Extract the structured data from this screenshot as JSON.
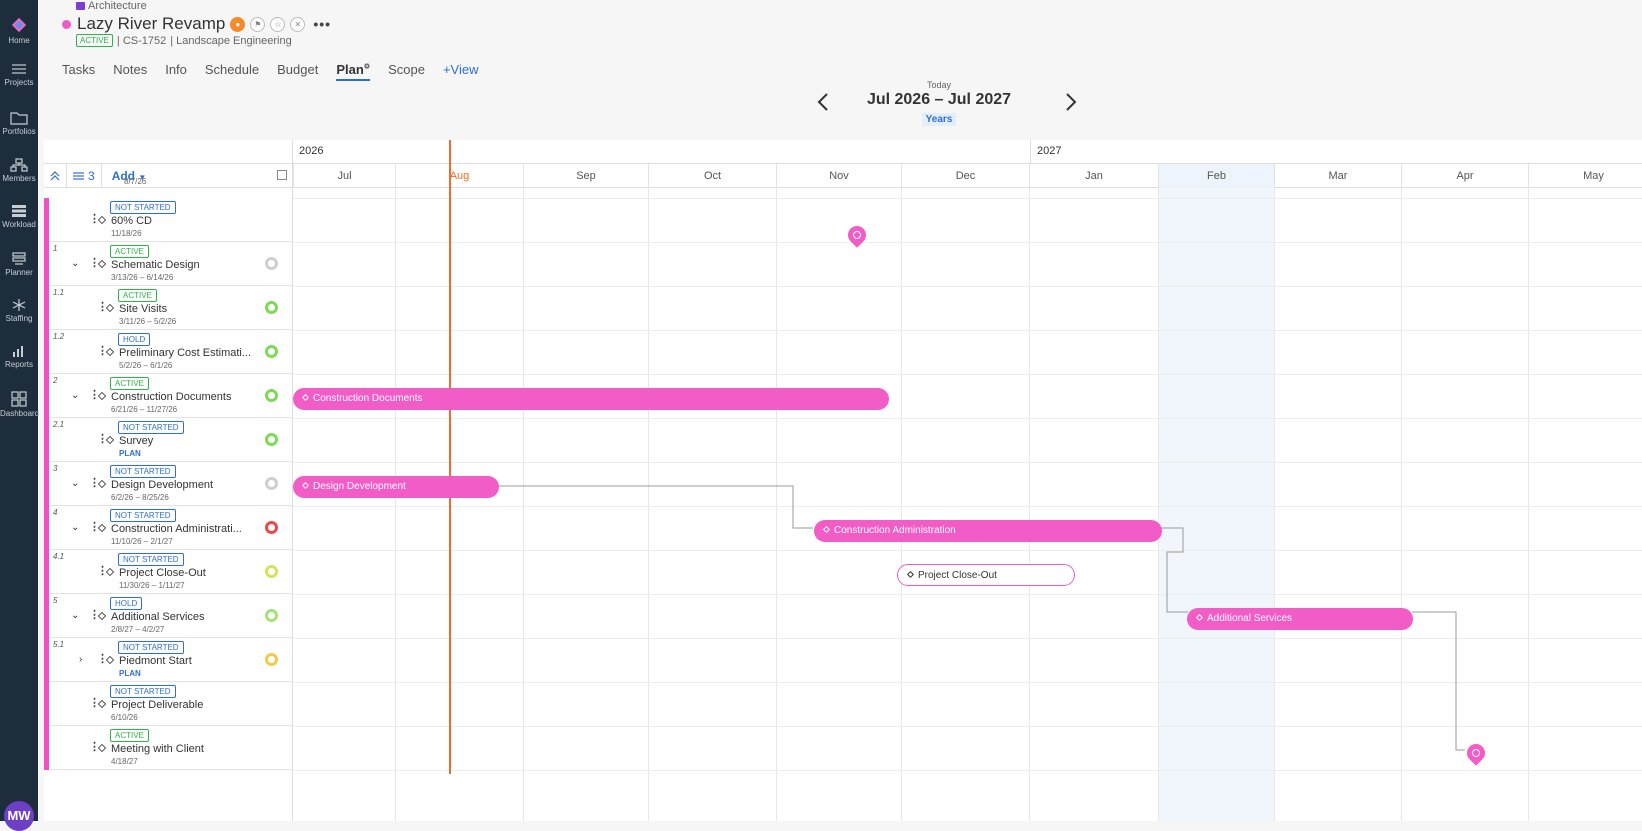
{
  "sidebar": {
    "items": [
      {
        "label": "Home",
        "icon": "home-icon"
      },
      {
        "label": "Projects",
        "icon": "list-icon"
      },
      {
        "label": "Portfolios",
        "icon": "folder-icon"
      },
      {
        "label": "Members",
        "icon": "members-icon"
      },
      {
        "label": "Workload",
        "icon": "grid-icon"
      },
      {
        "label": "Planner",
        "icon": "planner-icon"
      },
      {
        "label": "Staffing",
        "icon": "staffing-icon"
      },
      {
        "label": "Reports",
        "icon": "bar-chart-icon"
      },
      {
        "label": "Dashboard",
        "icon": "dashboard-icon"
      }
    ],
    "avatar_initials": "MW"
  },
  "header": {
    "breadcrumb": "Architecture",
    "title": "Lazy River Revamp",
    "status": "ACTIVE",
    "project_code": "| CS-1752",
    "client": "| Landscape Engineering",
    "more": "•••"
  },
  "tabs": [
    {
      "label": "Tasks"
    },
    {
      "label": "Notes"
    },
    {
      "label": "Info"
    },
    {
      "label": "Schedule"
    },
    {
      "label": "Budget"
    },
    {
      "label": "Plan",
      "active": true
    },
    {
      "label": "Scope"
    },
    {
      "label": "+View"
    }
  ],
  "date_nav": {
    "today": "Today",
    "range": "Jul 2026 – Jul 2027",
    "scale": "Years"
  },
  "toolbar": {
    "filter_count": "3",
    "add_label": "Add"
  },
  "timeline": {
    "years": [
      "2026",
      "2027"
    ],
    "months": [
      "Jul",
      "Aug",
      "Sep",
      "Oct",
      "Nov",
      "Dec",
      "Jan",
      "Feb",
      "Mar",
      "Apr",
      "May"
    ],
    "current_month": "Aug",
    "today_color": "#f06b2b",
    "accent": "#f25cc6"
  },
  "top_partial_date": "8/7/26",
  "rows": [
    {
      "num": "",
      "status": "NOT STARTED",
      "name": "60% CD",
      "dates": "11/18/26",
      "type": "milestone",
      "indent": 0
    },
    {
      "num": "1",
      "status": "ACTIVE",
      "name": "Schematic Design",
      "dates": "3/13/26 – 6/14/26",
      "type": "phase",
      "indent": 0
    },
    {
      "num": "1.1",
      "status": "ACTIVE",
      "name": "Site Visits",
      "dates": "3/11/26 – 5/2/26",
      "type": "sub",
      "indent": 1
    },
    {
      "num": "1.2",
      "status": "HOLD",
      "name": "Preliminary Cost Estimati...",
      "dates": "5/2/26 – 6/1/26",
      "type": "sub",
      "indent": 1
    },
    {
      "num": "2",
      "status": "ACTIVE",
      "name": "Construction Documents",
      "dates": "6/21/26 – 11/27/26",
      "type": "phase",
      "indent": 0
    },
    {
      "num": "2.1",
      "status": "NOT STARTED",
      "name": "Survey",
      "dates": "PLAN",
      "type": "sub",
      "indent": 1
    },
    {
      "num": "3",
      "status": "NOT STARTED",
      "name": "Design Development",
      "dates": "6/2/26 – 8/25/26",
      "type": "phase",
      "indent": 0
    },
    {
      "num": "4",
      "status": "NOT STARTED",
      "name": "Construction Administrati...",
      "dates": "11/10/26 – 2/1/27",
      "type": "phase",
      "indent": 0
    },
    {
      "num": "4.1",
      "status": "NOT STARTED",
      "name": "Project Close-Out",
      "dates": "11/30/26 – 1/11/27",
      "type": "sub",
      "indent": 1
    },
    {
      "num": "5",
      "status": "HOLD",
      "name": "Additional Services",
      "dates": "2/8/27 – 4/2/27",
      "type": "phase",
      "indent": 0
    },
    {
      "num": "5.1",
      "status": "NOT STARTED",
      "name": "Piedmont Start",
      "dates": "PLAN",
      "type": "sub",
      "indent": 1
    },
    {
      "num": "",
      "status": "NOT STARTED",
      "name": "Project Deliverable",
      "dates": "6/10/26",
      "type": "milestone",
      "indent": 0
    },
    {
      "num": "",
      "status": "ACTIVE",
      "name": "Meeting with Client",
      "dates": "4/18/27",
      "type": "milestone",
      "indent": 0
    }
  ],
  "bars": [
    {
      "label": "Construction Documents"
    },
    {
      "label": "Design Development"
    },
    {
      "label": "Construction Administration"
    },
    {
      "label": "Project Close-Out"
    },
    {
      "label": "Additional Services"
    }
  ]
}
